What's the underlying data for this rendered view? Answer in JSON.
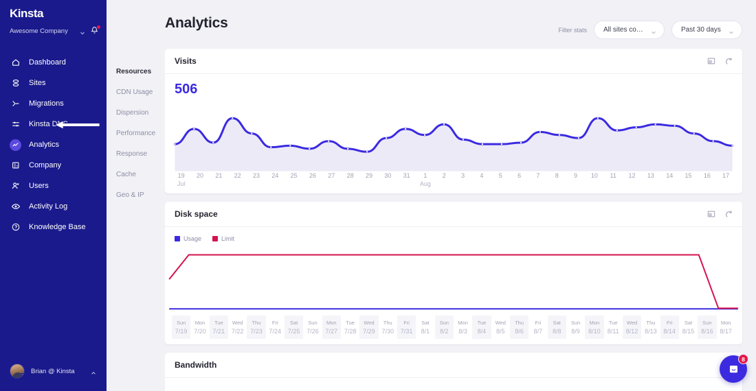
{
  "sidebar": {
    "logo": "Kinsta",
    "company": "Awesome Company",
    "company_chevron_icon": "chevron-down-icon",
    "notifications_icon": "bell-icon",
    "items": [
      {
        "label": "Dashboard",
        "icon": "home-icon"
      },
      {
        "label": "Sites",
        "icon": "sites-icon"
      },
      {
        "label": "Migrations",
        "icon": "migrations-icon"
      },
      {
        "label": "Kinsta DNS",
        "icon": "dns-icon"
      },
      {
        "label": "Analytics",
        "icon": "analytics-icon"
      },
      {
        "label": "Company",
        "icon": "company-icon"
      },
      {
        "label": "Users",
        "icon": "users-icon"
      },
      {
        "label": "Activity Log",
        "icon": "eye-icon"
      },
      {
        "label": "Knowledge Base",
        "icon": "help-icon"
      }
    ],
    "active_item": "Analytics",
    "user": {
      "name": "Brian @ Kinsta",
      "chevron_icon": "chevron-up-icon"
    }
  },
  "subnav": {
    "items": [
      {
        "label": "Resources"
      },
      {
        "label": "CDN Usage"
      },
      {
        "label": "Dispersion"
      },
      {
        "label": "Performance"
      },
      {
        "label": "Response"
      },
      {
        "label": "Cache"
      },
      {
        "label": "Geo & IP"
      }
    ],
    "active_item": "Resources"
  },
  "header": {
    "title": "Analytics",
    "filter_label": "Filter stats",
    "site_filter": {
      "value": "All sites combin...",
      "chevron_icon": "chevron-down-icon"
    },
    "date_filter": {
      "value": "Past 30 days",
      "chevron_icon": "chevron-down-icon"
    }
  },
  "cards": {
    "visits": {
      "title": "Visits",
      "metric": "506",
      "expand_icon": "expand-icon",
      "refresh_icon": "refresh-icon"
    },
    "disk": {
      "title": "Disk space",
      "expand_icon": "expand-icon",
      "refresh_icon": "refresh-icon",
      "legend": [
        {
          "label": "Usage",
          "color": "#3b2ae0"
        },
        {
          "label": "Limit",
          "color": "#d4134e"
        }
      ]
    },
    "bandwidth": {
      "title": "Bandwidth",
      "expand_icon": "expand-icon"
    }
  },
  "chat": {
    "badge": "8",
    "icon": "chat-icon"
  },
  "chart_data": [
    {
      "type": "line",
      "title": "Visits",
      "id": "visits",
      "xlabel": "",
      "ylabel": "",
      "grid": false,
      "legend": "none",
      "line_color": "#3b2ae0",
      "fill_color": "#eceaf7",
      "ylim": [
        0,
        40
      ],
      "categories": [
        "19 Jul",
        "20",
        "21",
        "22",
        "23",
        "24",
        "25",
        "26",
        "27",
        "28",
        "29",
        "30",
        "31",
        "1 Aug",
        "2",
        "3",
        "4",
        "5",
        "6",
        "7",
        "8",
        "9",
        "10",
        "11",
        "12",
        "13",
        "14",
        "15",
        "16",
        "17"
      ],
      "tick_labels": [
        {
          "main": "19",
          "sub": "Jul"
        },
        {
          "main": "20",
          "sub": ""
        },
        {
          "main": "21",
          "sub": ""
        },
        {
          "main": "22",
          "sub": ""
        },
        {
          "main": "23",
          "sub": ""
        },
        {
          "main": "24",
          "sub": ""
        },
        {
          "main": "25",
          "sub": ""
        },
        {
          "main": "26",
          "sub": ""
        },
        {
          "main": "27",
          "sub": ""
        },
        {
          "main": "28",
          "sub": ""
        },
        {
          "main": "29",
          "sub": ""
        },
        {
          "main": "30",
          "sub": ""
        },
        {
          "main": "31",
          "sub": ""
        },
        {
          "main": "1",
          "sub": "Aug"
        },
        {
          "main": "2",
          "sub": ""
        },
        {
          "main": "3",
          "sub": ""
        },
        {
          "main": "4",
          "sub": ""
        },
        {
          "main": "5",
          "sub": ""
        },
        {
          "main": "6",
          "sub": ""
        },
        {
          "main": "7",
          "sub": ""
        },
        {
          "main": "8",
          "sub": ""
        },
        {
          "main": "9",
          "sub": ""
        },
        {
          "main": "10",
          "sub": ""
        },
        {
          "main": "11",
          "sub": ""
        },
        {
          "main": "12",
          "sub": ""
        },
        {
          "main": "13",
          "sub": ""
        },
        {
          "main": "14",
          "sub": ""
        },
        {
          "main": "15",
          "sub": ""
        },
        {
          "main": "16",
          "sub": ""
        },
        {
          "main": "17",
          "sub": ""
        }
      ],
      "values": [
        14,
        24,
        15,
        31,
        21,
        12,
        13,
        11,
        16,
        11,
        9,
        18,
        24,
        20,
        27,
        17,
        14,
        14,
        15,
        22,
        20,
        18,
        31,
        23,
        25,
        27,
        26,
        21,
        16,
        13
      ]
    },
    {
      "type": "line",
      "title": "Disk space",
      "id": "disk",
      "xlabel": "",
      "ylabel": "",
      "grid": false,
      "legend": "top-left",
      "ylim": [
        0,
        110
      ],
      "categories": [
        "Sun 7/19",
        "Mon 7/20",
        "Tue 7/21",
        "Wed 7/22",
        "Thu 7/23",
        "Fri 7/24",
        "Sat 7/25",
        "Sun 7/26",
        "Mon 7/27",
        "Tue 7/28",
        "Wed 7/29",
        "Thu 7/30",
        "Fri 7/31",
        "Sat 8/1",
        "Sun 8/2",
        "Mon 8/3",
        "Tue 8/4",
        "Wed 8/5",
        "Thu 8/6",
        "Fri 8/7",
        "Sat 8/8",
        "Sun 8/9",
        "Mon 8/10",
        "Tue 8/11",
        "Wed 8/12",
        "Thu 8/13",
        "Fri 8/14",
        "Sat 8/15",
        "Sun 8/16",
        "Mon 8/17"
      ],
      "tick_labels": [
        {
          "main": "Sun",
          "sub": "7/19"
        },
        {
          "main": "Mon",
          "sub": "7/20"
        },
        {
          "main": "Tue",
          "sub": "7/21"
        },
        {
          "main": "Wed",
          "sub": "7/22"
        },
        {
          "main": "Thu",
          "sub": "7/23"
        },
        {
          "main": "Fri",
          "sub": "7/24"
        },
        {
          "main": "Sat",
          "sub": "7/25"
        },
        {
          "main": "Sun",
          "sub": "7/26"
        },
        {
          "main": "Mon",
          "sub": "7/27"
        },
        {
          "main": "Tue",
          "sub": "7/28"
        },
        {
          "main": "Wed",
          "sub": "7/29"
        },
        {
          "main": "Thu",
          "sub": "7/30"
        },
        {
          "main": "Fri",
          "sub": "7/31"
        },
        {
          "main": "Sat",
          "sub": "8/1"
        },
        {
          "main": "Sun",
          "sub": "8/2"
        },
        {
          "main": "Mon",
          "sub": "8/3"
        },
        {
          "main": "Tue",
          "sub": "8/4"
        },
        {
          "main": "Wed",
          "sub": "8/5"
        },
        {
          "main": "Thu",
          "sub": "8/6"
        },
        {
          "main": "Fri",
          "sub": "8/7"
        },
        {
          "main": "Sat",
          "sub": "8/8"
        },
        {
          "main": "Sun",
          "sub": "8/9"
        },
        {
          "main": "Mon",
          "sub": "8/10"
        },
        {
          "main": "Tue",
          "sub": "8/11"
        },
        {
          "main": "Wed",
          "sub": "8/12"
        },
        {
          "main": "Thu",
          "sub": "8/13"
        },
        {
          "main": "Fri",
          "sub": "8/14"
        },
        {
          "main": "Sat",
          "sub": "8/15"
        },
        {
          "main": "Sun",
          "sub": "8/16"
        },
        {
          "main": "Mon",
          "sub": "8/17"
        }
      ],
      "series": [
        {
          "name": "Usage",
          "color": "#3b2ae0",
          "values": [
            5,
            5,
            5,
            5,
            5,
            5,
            5,
            5,
            5,
            5,
            5,
            5,
            5,
            5,
            5,
            5,
            5,
            5,
            5,
            5,
            5,
            5,
            5,
            5,
            5,
            5,
            5,
            5,
            5,
            5
          ]
        },
        {
          "name": "Limit",
          "color": "#d4134e",
          "values": [
            57,
            100,
            100,
            100,
            100,
            100,
            100,
            100,
            100,
            100,
            100,
            100,
            100,
            100,
            100,
            100,
            100,
            100,
            100,
            100,
            100,
            100,
            100,
            100,
            100,
            100,
            100,
            100,
            6,
            6
          ]
        }
      ]
    }
  ]
}
